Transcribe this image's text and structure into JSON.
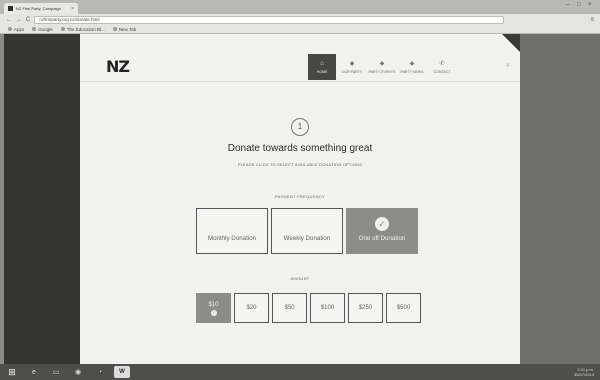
{
  "browser": {
    "tab_title": "NZ First Party, Campaign",
    "tab_close": "×",
    "window_controls": [
      "–",
      "□",
      "×"
    ],
    "nav_glyphs": [
      "←",
      "→",
      "C"
    ],
    "address": "nzfirstparty.org.nz/donate.html",
    "menu_glyph": "≡",
    "bookmarks": [
      "Apps",
      "Google",
      "The Education Bl...",
      "New Tab"
    ]
  },
  "site": {
    "logo": "NZ",
    "nav": [
      {
        "icon": "⌂",
        "label": "HOME",
        "active": true
      },
      {
        "icon": "◆",
        "label": "OUR PARTY"
      },
      {
        "icon": "◆",
        "label": "PARTY EVENTS"
      },
      {
        "icon": "◆",
        "label": "PARTY NEWS"
      },
      {
        "icon": "✆",
        "label": "CONTACT"
      }
    ],
    "search_glyph": "⌕"
  },
  "donate": {
    "step": "1",
    "title": "Donate towards something great",
    "subtitle": "PLEASE CLICK TO SELECT AVAILABLE DONATION OPTIONS",
    "frequency_label": "PAYMENT FREQUENCY",
    "frequencies": [
      "Monthly Donation",
      "Weekly Donation",
      "One off Donation"
    ],
    "selected_frequency_index": 2,
    "check_glyph": "✓",
    "amount_label": "AMOUNT",
    "amounts": [
      "$10",
      "$20",
      "$50",
      "$100",
      "$250",
      "$500"
    ],
    "selected_amount_index": 0
  },
  "taskbar": {
    "start_glyph": "⊞",
    "app_glyphs": [
      "e",
      "▭",
      "◉",
      "◔",
      "W"
    ],
    "time": "2:41 p.m.",
    "date": "30/07/2014"
  },
  "colors": {
    "selected_fill": "#8c8c89",
    "page_bg": "#f1f1ef",
    "left_sidebar": "#353533"
  }
}
